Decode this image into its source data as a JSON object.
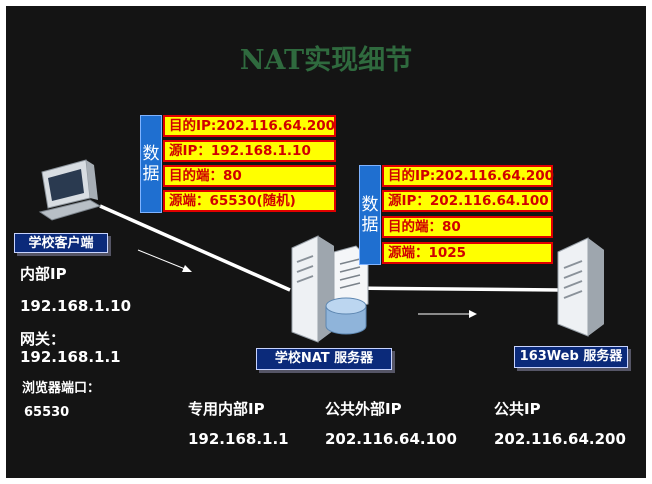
{
  "title": "NAT实现细节",
  "packet_left": {
    "side_label": [
      "数",
      "据"
    ],
    "rows": [
      "目的IP:202.116.64.200",
      "源IP：192.168.1.10",
      "目的端：80",
      "源端：65530(随机)"
    ]
  },
  "packet_right": {
    "side_label": [
      "数",
      "据"
    ],
    "rows": [
      "目的IP:202.116.64.200",
      "源IP：202.116.64.100",
      "目的端：80",
      "源端：1025"
    ]
  },
  "client": {
    "label": "学校客户端",
    "inner_ip_label": "内部IP",
    "inner_ip": "192.168.1.10",
    "gateway_label": "网关：",
    "gateway": "192.168.1.1",
    "browser_port_label": "浏览器端口：",
    "browser_port": "65530"
  },
  "nat_server": {
    "label": "学校NAT 服务器"
  },
  "web_server": {
    "label": "163Web 服务器"
  },
  "addresses": [
    {
      "label": "专用内部IP",
      "value": "192.168.1.1"
    },
    {
      "label": "公共外部IP",
      "value": "202.116.64.100"
    },
    {
      "label": "公共IP",
      "value": "202.116.64.200"
    }
  ]
}
